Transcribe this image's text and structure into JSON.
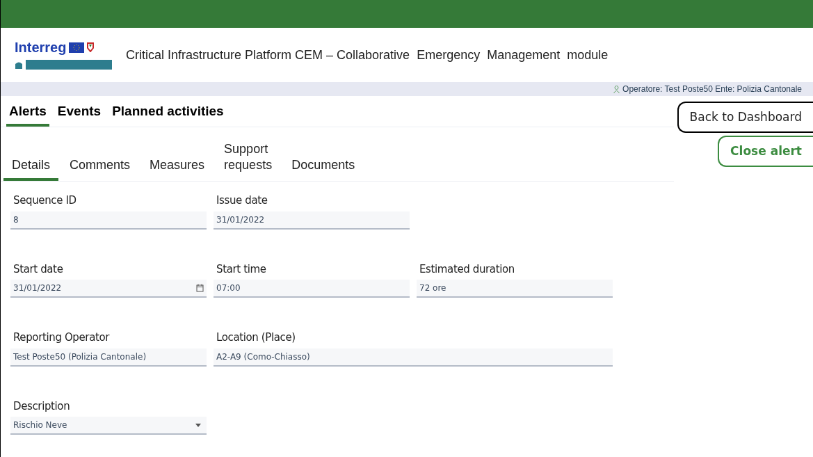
{
  "header": {
    "logo": {
      "name": "Interreg"
    },
    "title": "Critical Infrastructure Platform CEM – Collaborative  Emergency  Management  module"
  },
  "user_bar": {
    "text": "Operatore: Test Poste50 Ente: Polizia Cantonale"
  },
  "main_tabs": [
    {
      "label": "Alerts",
      "selected": true
    },
    {
      "label": "Events",
      "selected": false
    },
    {
      "label": "Planned activities",
      "selected": false
    }
  ],
  "buttons": [
    {
      "label": "Back to Dashboard",
      "kind": "neutral"
    },
    {
      "label": "Close alert",
      "kind": "primary"
    }
  ],
  "sub_tabs": [
    {
      "label": "Details",
      "selected": true
    },
    {
      "label": "Comments",
      "selected": false
    },
    {
      "label": "Measures",
      "selected": false
    },
    {
      "label": "Support requests",
      "selected": false
    },
    {
      "label": "Documents",
      "selected": false
    }
  ],
  "form_rows": [
    {
      "fields": [
        {
          "label": "Sequence ID",
          "value": "8",
          "kind": "text"
        },
        {
          "label": "Issue date",
          "value": "31/01/2022",
          "kind": "text"
        }
      ]
    },
    {
      "fields": [
        {
          "label": "Start date",
          "value": "31/01/2022",
          "kind": "date"
        },
        {
          "label": "Start time",
          "value": "07:00",
          "kind": "text"
        },
        {
          "label": "Estimated duration",
          "value": "72 ore",
          "kind": "text"
        }
      ]
    },
    {
      "fields": [
        {
          "label": "Reporting Operator",
          "value": "Test Poste50 (Polizia Cantonale)",
          "kind": "text"
        },
        {
          "label": "Location (Place)",
          "value": "A2-A9 (Como-Chiasso)",
          "kind": "wide"
        }
      ]
    },
    {
      "fields": [
        {
          "label": "Description",
          "value": "Rischio Neve",
          "kind": "select"
        }
      ]
    }
  ]
}
